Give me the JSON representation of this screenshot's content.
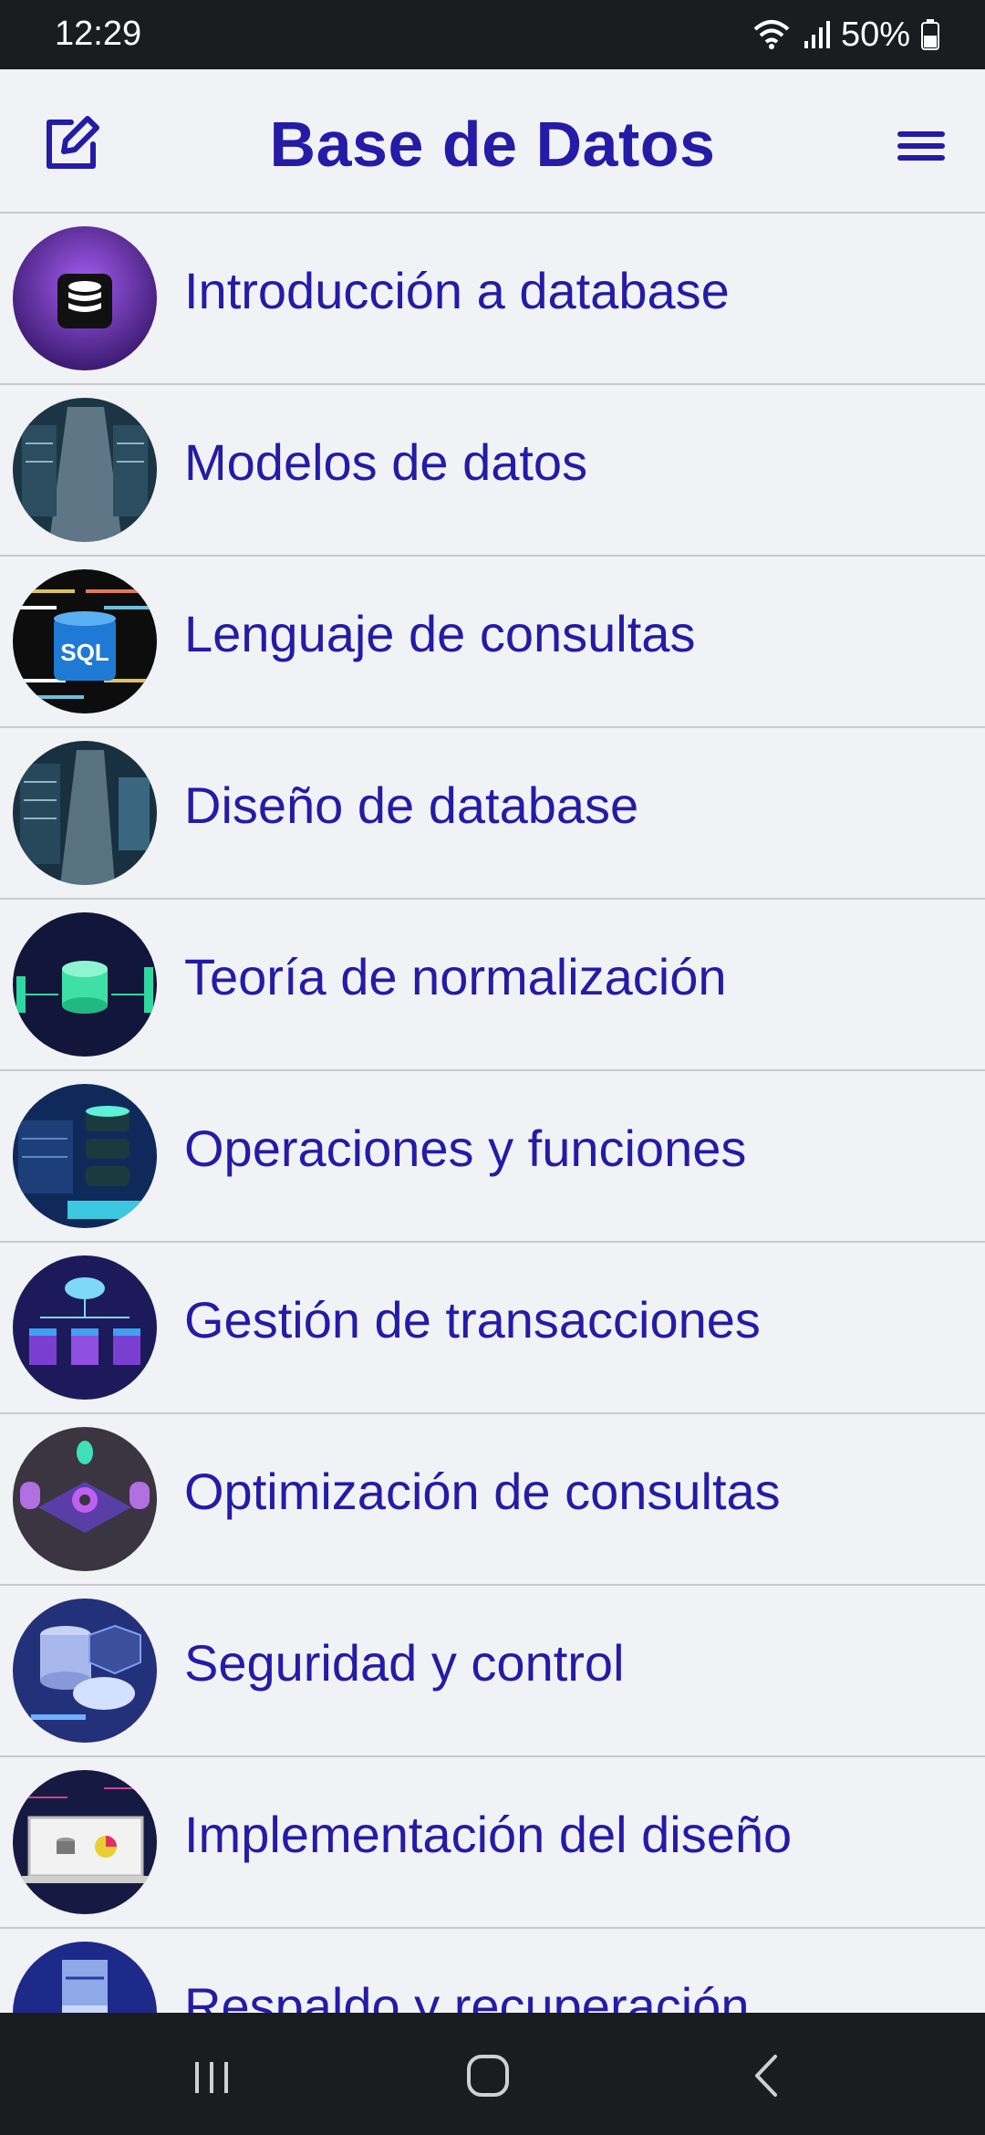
{
  "status": {
    "time": "12:29",
    "battery": "50%"
  },
  "header": {
    "title": "Base de Datos",
    "left_icon": "edit-icon",
    "right_icon": "menu-icon"
  },
  "accent": "#241ba6",
  "topics": [
    {
      "label": "Introducción a database",
      "icon": "database-icon"
    },
    {
      "label": "Modelos de datos",
      "icon": "server-room-icon"
    },
    {
      "label": "Lenguaje de consultas",
      "icon": "sql-icon",
      "badge": "SQL"
    },
    {
      "label": "Diseño de database",
      "icon": "server-room-icon"
    },
    {
      "label": "Teoría de normalización",
      "icon": "database-cylinder-icon"
    },
    {
      "label": "Operaciones y funciones",
      "icon": "server-stack-icon"
    },
    {
      "label": "Gestión de transacciones",
      "icon": "cloud-network-icon"
    },
    {
      "label": "Optimización de consultas",
      "icon": "gear-icon"
    },
    {
      "label": "Seguridad y control",
      "icon": "security-key-icon"
    },
    {
      "label": "Implementación del diseño",
      "icon": "laptop-chart-icon"
    },
    {
      "label": "Respaldo y recuperación",
      "icon": "backup-server-icon"
    }
  ]
}
